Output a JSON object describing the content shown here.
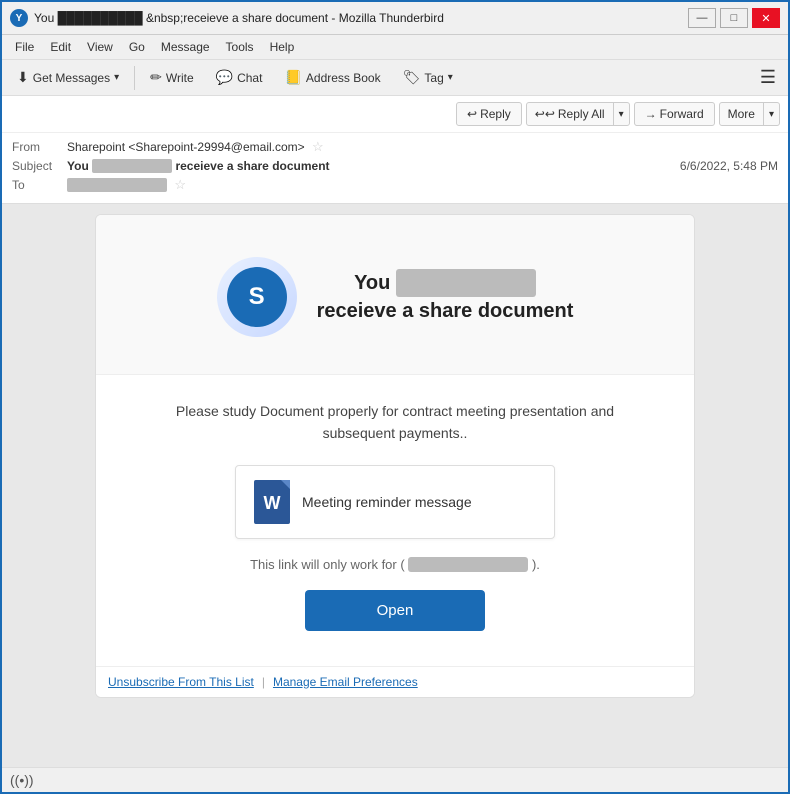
{
  "window": {
    "title": "You  &nbsp;receieve a share document - Mozilla Thunderbird",
    "title_display": "You ██████████ &nbsp;receieve a share document - Mozilla Thunderbird",
    "avatar_letter": "Y"
  },
  "window_controls": {
    "minimize": "—",
    "maximize": "□",
    "close": "✕"
  },
  "menu": {
    "items": [
      "File",
      "Edit",
      "View",
      "Go",
      "Message",
      "Tools",
      "Help"
    ]
  },
  "toolbar": {
    "get_messages_label": "Get Messages",
    "write_label": "Write",
    "chat_label": "Chat",
    "address_book_label": "Address Book",
    "tag_label": "Tag"
  },
  "actions": {
    "reply_label": "Reply",
    "reply_all_label": "Reply All",
    "forward_label": "Forward",
    "more_label": "More"
  },
  "email": {
    "from_label": "From",
    "from_name": "Sharepoint",
    "from_email": "Sharepoint-29994@email.com",
    "subject_label": "Subject",
    "subject_prefix": "You",
    "subject_blurred": "██████████",
    "subject_suffix": "&nbsp;receieve a share document",
    "subject_display": "You ██████████ &nbsp;receieve a share document",
    "to_label": "To",
    "to_blurred": "████████████",
    "date": "6/6/2022, 5:48 PM"
  },
  "body": {
    "hero_title_prefix": "You",
    "hero_title_blurred": "██████████████",
    "hero_title_suffix": "receieve a share document",
    "description": "Please study Document properly for contract meeting presentation and subsequent payments..",
    "doc_name": "Meeting reminder message",
    "link_info_prefix": "This link will only work for (",
    "link_blurred": "████████████",
    "link_info_suffix": ").",
    "open_button": "Open"
  },
  "footer": {
    "unsubscribe_label": "Unsubscribe From This List",
    "separator": "|",
    "manage_label": "Manage Email Preferences"
  },
  "status_bar": {
    "wifi_symbol": "((•))"
  }
}
